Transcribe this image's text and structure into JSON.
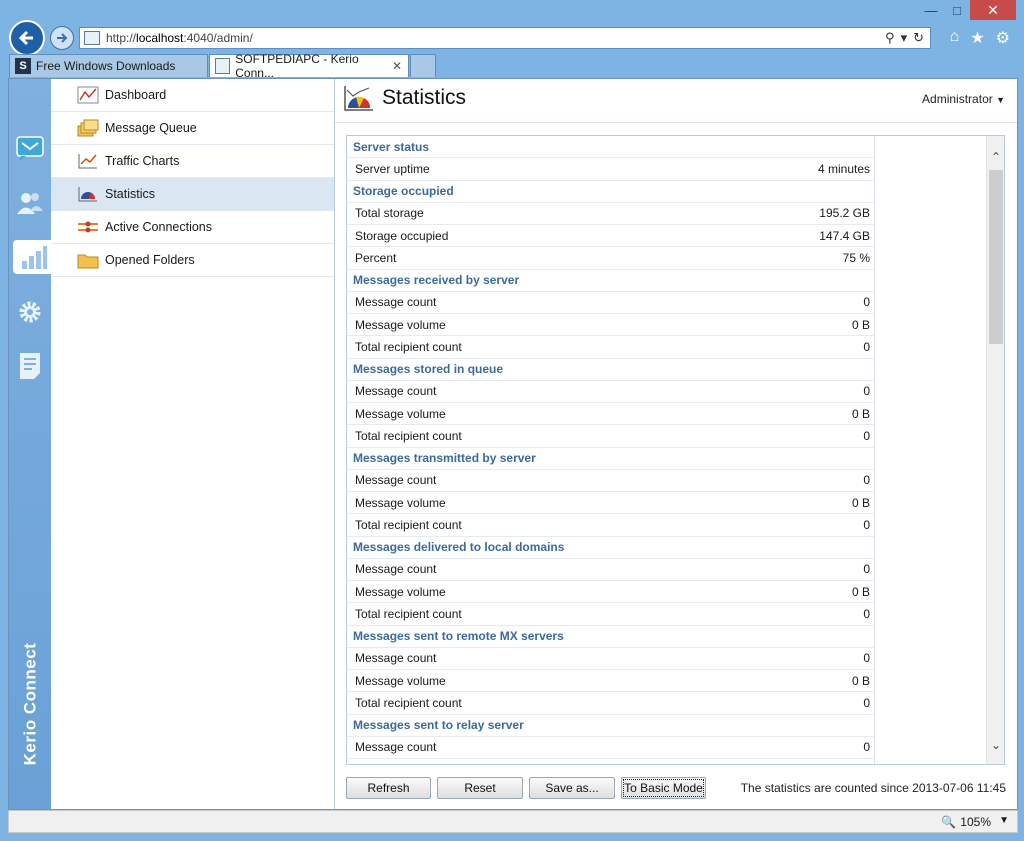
{
  "browser": {
    "url_prefix": "http://",
    "url_host": "localhost",
    "url_rest": ":4040/admin/",
    "tabs": [
      {
        "label": "Free Windows Downloads",
        "icon": "S"
      },
      {
        "label": "SOFTPEDIAPC - Kerio Conn...",
        "close": "✕"
      }
    ],
    "zoom": "105%"
  },
  "rail": {
    "brand": "Kerio Connect",
    "items": [
      "mail-icon",
      "users-icon",
      "statistics-icon",
      "settings-icon",
      "logs-icon"
    ]
  },
  "sidebar": {
    "items": [
      {
        "label": "Dashboard",
        "icon": "dashboard-icon"
      },
      {
        "label": "Message Queue",
        "icon": "message-queue-icon"
      },
      {
        "label": "Traffic Charts",
        "icon": "traffic-charts-icon"
      },
      {
        "label": "Statistics",
        "icon": "statistics-icon"
      },
      {
        "label": "Active Connections",
        "icon": "active-connections-icon"
      },
      {
        "label": "Opened Folders",
        "icon": "folder-icon"
      }
    ]
  },
  "header": {
    "title": "Statistics",
    "user": "Administrator"
  },
  "stats": [
    {
      "type": "section",
      "label": "Server status"
    },
    {
      "type": "row",
      "label": "Server uptime",
      "value": "4 minutes"
    },
    {
      "type": "section",
      "label": "Storage occupied"
    },
    {
      "type": "row",
      "label": "Total storage",
      "value": "195.2 GB"
    },
    {
      "type": "row",
      "label": "Storage occupied",
      "value": "147.4 GB"
    },
    {
      "type": "row",
      "label": "Percent",
      "value": "75 %"
    },
    {
      "type": "section",
      "label": "Messages received by server"
    },
    {
      "type": "row",
      "label": "Message count",
      "value": "0"
    },
    {
      "type": "row",
      "label": "Message volume",
      "value": "0 B"
    },
    {
      "type": "row",
      "label": "Total recipient count",
      "value": "0"
    },
    {
      "type": "section",
      "label": "Messages stored in queue"
    },
    {
      "type": "row",
      "label": "Message count",
      "value": "0"
    },
    {
      "type": "row",
      "label": "Message volume",
      "value": "0 B"
    },
    {
      "type": "row",
      "label": "Total recipient count",
      "value": "0"
    },
    {
      "type": "section",
      "label": "Messages transmitted by server"
    },
    {
      "type": "row",
      "label": "Message count",
      "value": "0"
    },
    {
      "type": "row",
      "label": "Message volume",
      "value": "0 B"
    },
    {
      "type": "row",
      "label": "Total recipient count",
      "value": "0"
    },
    {
      "type": "section",
      "label": "Messages delivered to local domains"
    },
    {
      "type": "row",
      "label": "Message count",
      "value": "0"
    },
    {
      "type": "row",
      "label": "Message volume",
      "value": "0 B"
    },
    {
      "type": "row",
      "label": "Total recipient count",
      "value": "0"
    },
    {
      "type": "section",
      "label": "Messages sent to remote MX servers"
    },
    {
      "type": "row",
      "label": "Message count",
      "value": "0"
    },
    {
      "type": "row",
      "label": "Message volume",
      "value": "0 B"
    },
    {
      "type": "row",
      "label": "Total recipient count",
      "value": "0"
    },
    {
      "type": "section",
      "label": "Messages sent to relay server"
    },
    {
      "type": "row",
      "label": "Message count",
      "value": "0"
    }
  ],
  "buttons": {
    "refresh": "Refresh",
    "reset": "Reset",
    "save_as": "Save as...",
    "basic_mode": "To Basic Mode"
  },
  "footer": {
    "since_label": "The statistics are counted since",
    "since_value": "2013-07-06 11:45"
  },
  "colors": {
    "section": "#3c6a9c",
    "rail": "#6aa1d6",
    "selected": "#dbe6f3"
  }
}
